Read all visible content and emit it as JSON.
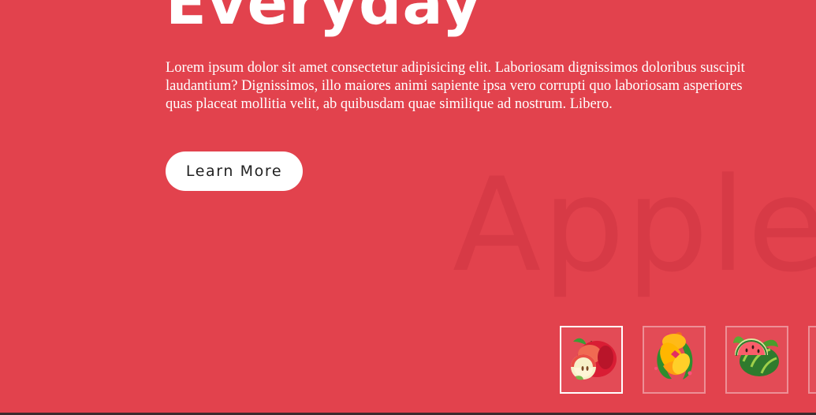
{
  "hero": {
    "heading": "Everyday",
    "description": "Lorem ipsum dolor sit amet consectetur adipisicing elit. Laboriosam dignissimos doloribus suscipit laudantium? Dignissimos, illo maiores animi sapiente ipsa vero corrupti quo laboriosam asperiores quas placeat mollitia velit, ab quibusdam quae similique ad nostrum. Libero.",
    "button_label": "Learn More",
    "watermark": "Apple"
  },
  "colors": {
    "background": "#e2424d",
    "button_bg": "#ffffff",
    "button_text": "#222222",
    "watermark": "#d73a46",
    "active_thumb_border": "#ffffff"
  },
  "thumbnails": [
    {
      "icon": "apple-icon",
      "active": true
    },
    {
      "icon": "mango-icon",
      "active": false
    },
    {
      "icon": "watermelon-icon",
      "active": false
    },
    {
      "icon": "partial-thumbnail",
      "active": false
    }
  ]
}
